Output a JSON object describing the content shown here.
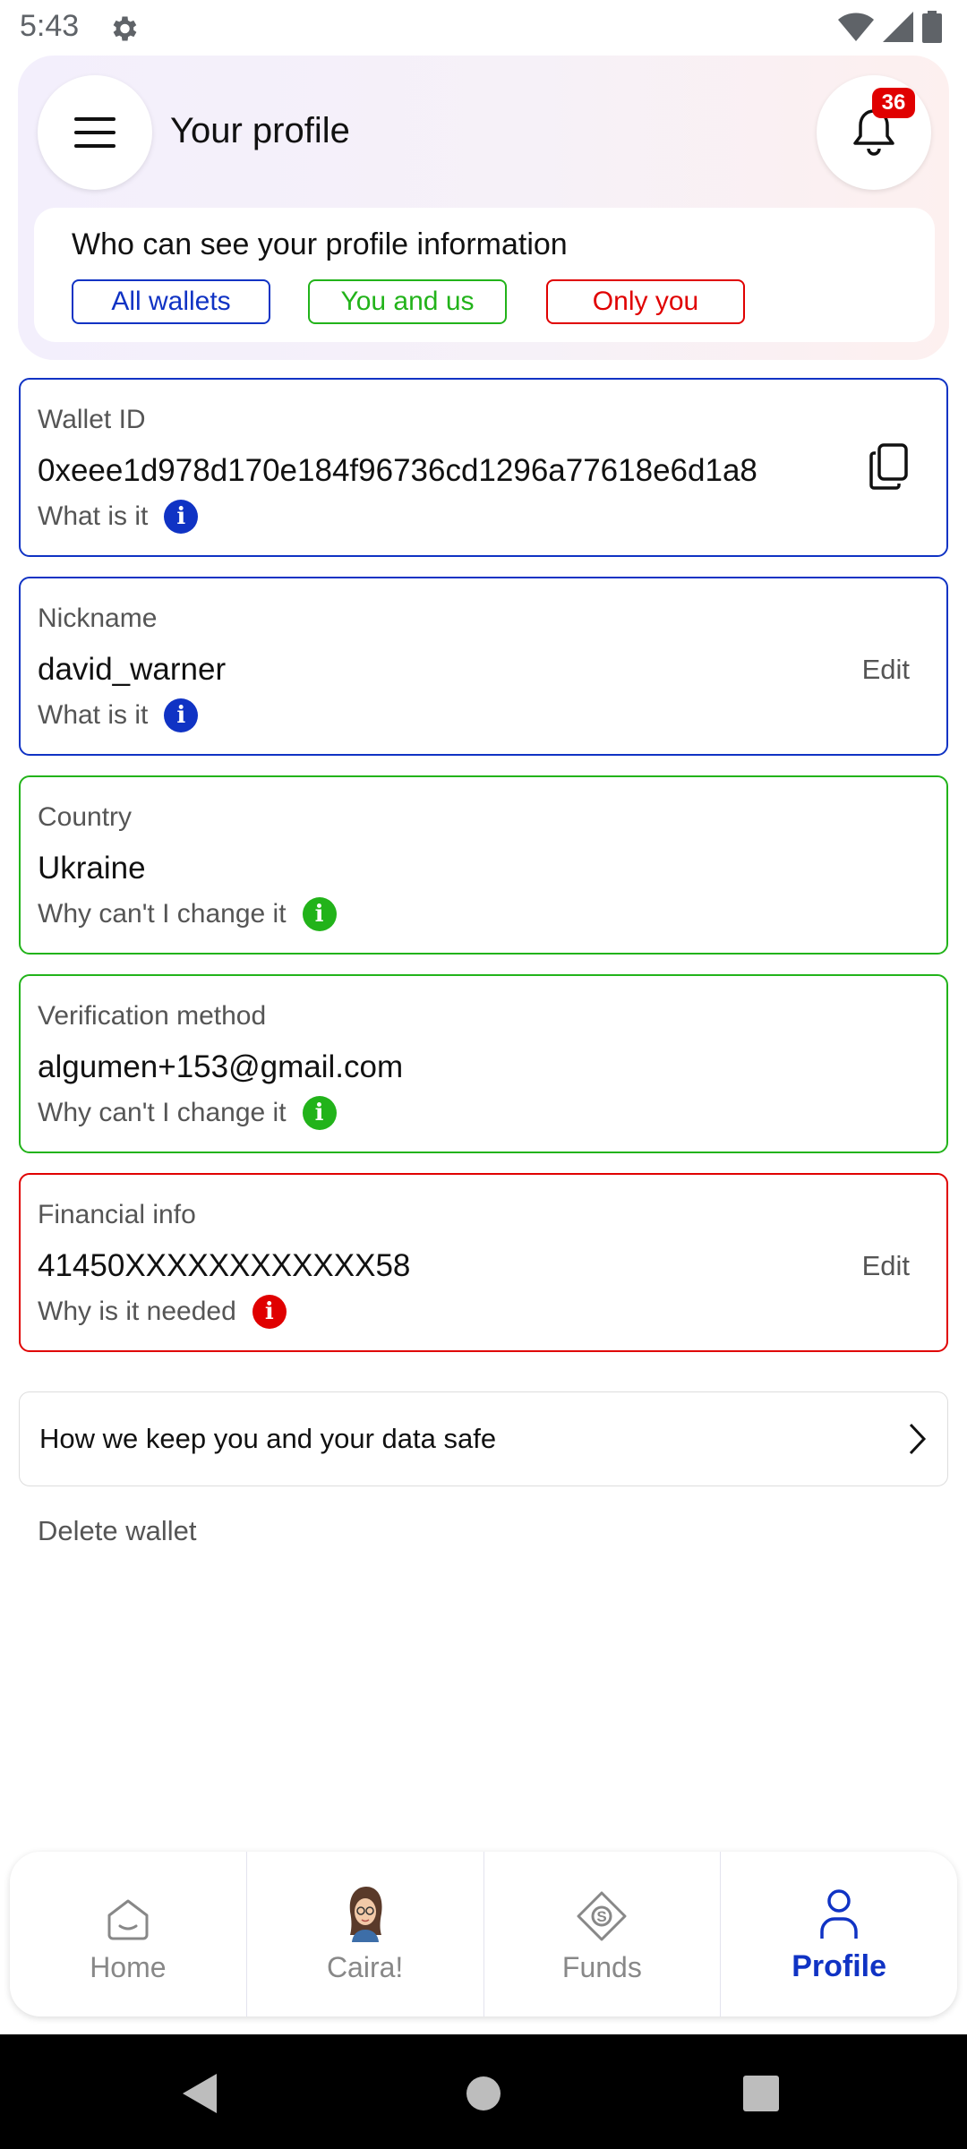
{
  "status_bar": {
    "time": "5:43"
  },
  "header": {
    "title": "Your profile",
    "notification_count": "36"
  },
  "visibility": {
    "heading": "Who can see your profile information",
    "options": [
      "All wallets",
      "You and us",
      "Only you"
    ]
  },
  "cards": [
    {
      "label": "Wallet ID",
      "value": "0xeee1d978d170e184f96736cd1296a77618e6d1a8",
      "help": "What is it",
      "action_icon": "copy-icon"
    },
    {
      "label": "Nickname",
      "value": "david_warner",
      "help": "What is it",
      "action": "Edit"
    },
    {
      "label": "Country",
      "value": "Ukraine",
      "help": "Why can't I change it"
    },
    {
      "label": "Verification method",
      "value": "algumen+153@gmail.com",
      "help": "Why can't I change it"
    },
    {
      "label": "Financial info",
      "value": "41450XXXXXXXXXXXX58",
      "help": "Why is it needed",
      "action": "Edit"
    }
  ],
  "colors": {
    "blue": "#1033c4",
    "green": "#22b31a",
    "red": "#e00000"
  },
  "safety_link": "How we keep you and your data safe",
  "delete_wallet": "Delete wallet",
  "nav": {
    "items": [
      {
        "label": "Home",
        "icon": "home-icon"
      },
      {
        "label": "Caira!",
        "icon": "assistant-avatar"
      },
      {
        "label": "Funds",
        "icon": "funds-icon"
      },
      {
        "label": "Profile",
        "icon": "person-icon"
      }
    ],
    "active": "Profile"
  }
}
